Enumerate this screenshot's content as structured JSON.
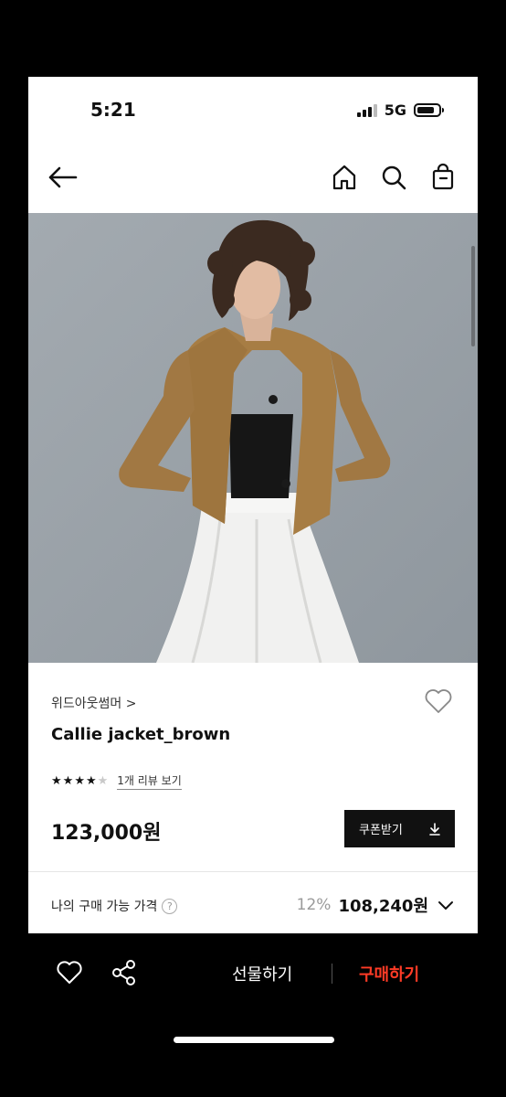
{
  "status_bar": {
    "time": "5:21",
    "network": "5G"
  },
  "nav": {
    "back_icon": "arrow-left-icon",
    "icons": [
      "home-icon",
      "search-icon",
      "shopping-bag-icon"
    ]
  },
  "product": {
    "brand": "위드아웃썸머 >",
    "name": "Callie jacket_brown",
    "rating": {
      "stars_filled": 4,
      "stars_total": 5,
      "review_link": "1개 리뷰 보기"
    },
    "price": "123,000원",
    "coupon_label": "쿠폰받기",
    "my_price_label": "나의 구매 가능 가격",
    "discount": "12%",
    "final_price": "108,240원"
  },
  "bottom_bar": {
    "gift_label": "선물하기",
    "buy_label": "구매하기"
  },
  "colors": {
    "buy_accent": "#ff3b26",
    "coupon_bg": "#111111",
    "jacket": "#a77d44",
    "backdrop": "#9ea5ab"
  }
}
